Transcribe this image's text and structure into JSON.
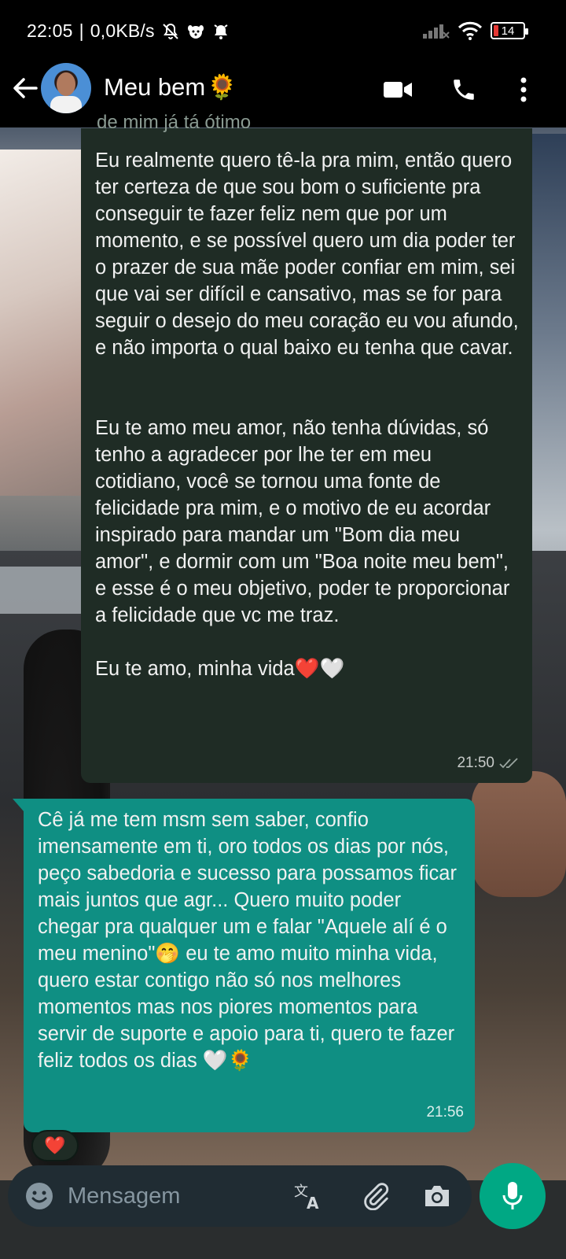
{
  "status_bar": {
    "time": "22:05",
    "separator": "|",
    "net_speed": "0,0KB/s",
    "battery_level": "14",
    "icons": [
      "bell-off-icon",
      "dog-app-icon",
      "alarm-icon",
      "signal-icon",
      "wifi-icon",
      "battery-icon"
    ]
  },
  "header": {
    "contact_name": "Meu bem",
    "contact_emoji": "🌻",
    "icons": [
      "back-arrow-icon",
      "video-call-icon",
      "phone-icon",
      "more-options-icon"
    ]
  },
  "messages": [
    {
      "direction": "incoming",
      "clipped_quote": "de mim já tá ótimo",
      "text": "Eu realmente quero tê-la pra mim, então quero ter certeza de que sou bom o suficiente pra conseguir te fazer feliz nem que por um momento, e se possível quero um dia poder ter o prazer de sua mãe poder confiar em mim, sei que vai ser difícil e cansativo, mas se for para seguir o desejo do meu coração eu vou afundo, e não importa o qual baixo eu tenha que cavar.\n\n\nEu te amo meu amor, não tenha dúvidas, só tenho a agradecer por lhe ter em meu cotidiano, você se tornou uma fonte de felicidade pra mim, e o motivo de eu acordar inspirado para mandar um \"Bom dia meu amor\", e dormir com um \"Boa noite meu bem\", e esse é o meu objetivo, poder te proporcionar a felicidade que vc me traz.\n\nEu te amo, minha vida❤️🤍",
      "time": "21:50",
      "status_icon": "double-check-icon"
    },
    {
      "direction": "outgoing",
      "text": "Cê já me tem msm sem saber, confio imensamente em ti, oro todos os dias por nós, peço sabedoria e sucesso para possamos ficar mais juntos que agr... Quero muito poder chegar pra qualquer um e falar \"Aquele alí é o meu menino\"🤭 eu te amo muito minha vida, quero estar contigo não só nos melhores momentos mas nos piores momentos para servir de suporte e apoio para ti, quero te fazer feliz todos os dias 🤍🌻",
      "time": "21:56",
      "reaction": "❤️"
    }
  ],
  "input_bar": {
    "placeholder": "Mensagem",
    "icons": [
      "emoji-icon",
      "translate-icon",
      "attach-icon",
      "camera-icon",
      "mic-icon"
    ]
  },
  "colors": {
    "incoming_bubble": "#1f2c25",
    "outgoing_bubble": "#0f8f83",
    "mic_button": "#00a884",
    "header_bg": "#000000"
  }
}
